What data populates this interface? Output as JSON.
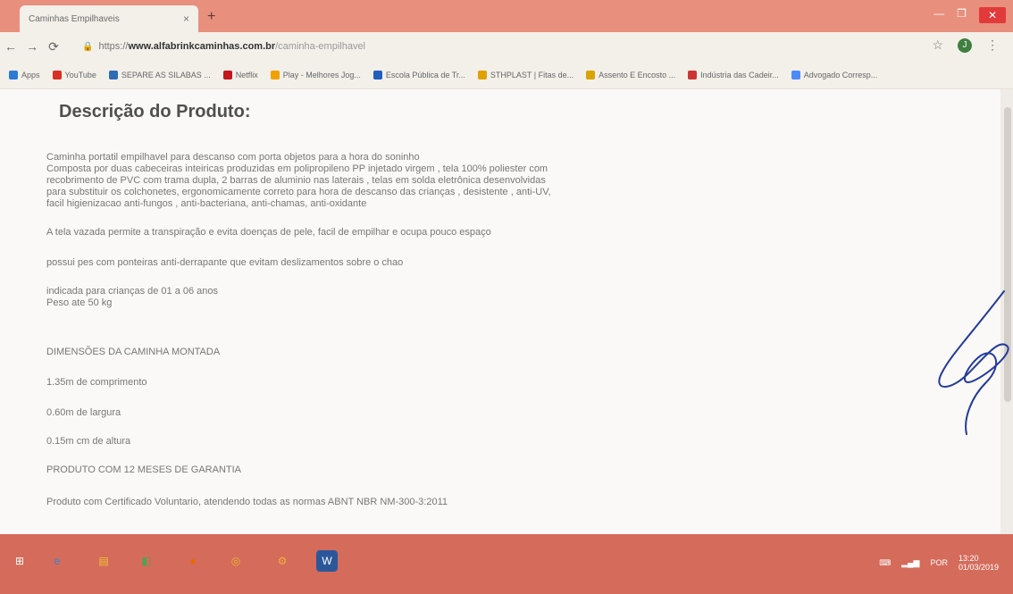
{
  "browser": {
    "tab_title": "Caminhas Empilhaveis",
    "tab_close": "×",
    "new_tab": "+",
    "url_prefix": "https://",
    "url_host": "www.alfabrinkcaminhas.com.br",
    "url_path": "/caminha-empilhavel",
    "icons": {
      "back": "back-arrow-icon",
      "forward": "forward-arrow-icon",
      "reload": "reload-icon",
      "lock": "lock-icon",
      "star": "star-icon",
      "menu": "more-vert-icon"
    },
    "avatar_initial": "J"
  },
  "bookmarks": [
    {
      "label": "Apps",
      "color": "#2b7bd4"
    },
    {
      "label": "YouTube",
      "color": "#d93025"
    },
    {
      "label": "SEPARE AS SILABAS ...",
      "color": "#2d6db5"
    },
    {
      "label": "Netflix",
      "color": "#c4161c"
    },
    {
      "label": "Play - Melhores Jog...",
      "color": "#f0a000"
    },
    {
      "label": "Escola Pública de Tr...",
      "color": "#1f5fbf"
    },
    {
      "label": "STHPLAST | Fitas de...",
      "color": "#e0a100"
    },
    {
      "label": "Assento E Encosto ...",
      "color": "#d9a300"
    },
    {
      "label": "Indústria das Cadeir...",
      "color": "#cc3333"
    },
    {
      "label": "Advogado Corresp...",
      "color": "#4c8bf5"
    }
  ],
  "page": {
    "title": "Descrição do Produto:",
    "paragraphs": [
      "Caminha portatil empilhavel para descanso com porta objetos para a hora do soninho",
      "Composta por duas cabeceiras inteiricas produzidas em polipropileno PP injetado virgem , tela 100% poliester com",
      "recobrimento de PVC com trama dupla, 2 barras de aluminio nas laterais , telas em solda eletrônica desenvolvidas",
      "para substituir os colchonetes, ergonomicamente correto para hora de descanso das crianças , desistente , anti-UV,",
      "facil higienizacao anti-fungos , anti-bacteriana, anti-chamas, anti-oxidante",
      "A tela vazada permite a transpiração e evita doenças de pele, facil de empilhar e ocupa pouco espaço",
      "possui pes com ponteiras anti-derrapante que evitam deslizamentos sobre o chao",
      "indicada para crianças de 01 a 06 anos",
      "Peso ate 50 kg",
      "DIMENSÕES DA CAMINHA MONTADA",
      "1.35m de comprimento",
      "0.60m de largura",
      "0.15m cm de altura",
      "PRODUTO COM 12 MESES DE GARANTIA",
      "Produto com Certificado Voluntario, atendendo todas as normas ABNT NBR NM-300-3:2011"
    ]
  },
  "taskbar": {
    "items": [
      {
        "name": "windows-start-icon",
        "color": "#ffffff",
        "symbol": "⊞"
      },
      {
        "name": "internet-explorer-icon",
        "color": "#2a88d8",
        "symbol": "e"
      },
      {
        "name": "file-explorer-icon",
        "color": "#f1c232",
        "symbol": "▤"
      },
      {
        "name": "store-icon",
        "color": "#4fa34f",
        "symbol": "◧"
      },
      {
        "name": "firefox-icon",
        "color": "#e66b00",
        "symbol": "●"
      },
      {
        "name": "chrome-icon",
        "color": "#e9bc2a",
        "symbol": "◎"
      },
      {
        "name": "settings-icon",
        "color": "#f0b040",
        "symbol": "⚙"
      },
      {
        "name": "word-icon",
        "color": "#2b579a",
        "symbol": "W"
      }
    ],
    "tray_lang": "POR",
    "tray_time": "13:20",
    "tray_date": "01/03/2019"
  }
}
